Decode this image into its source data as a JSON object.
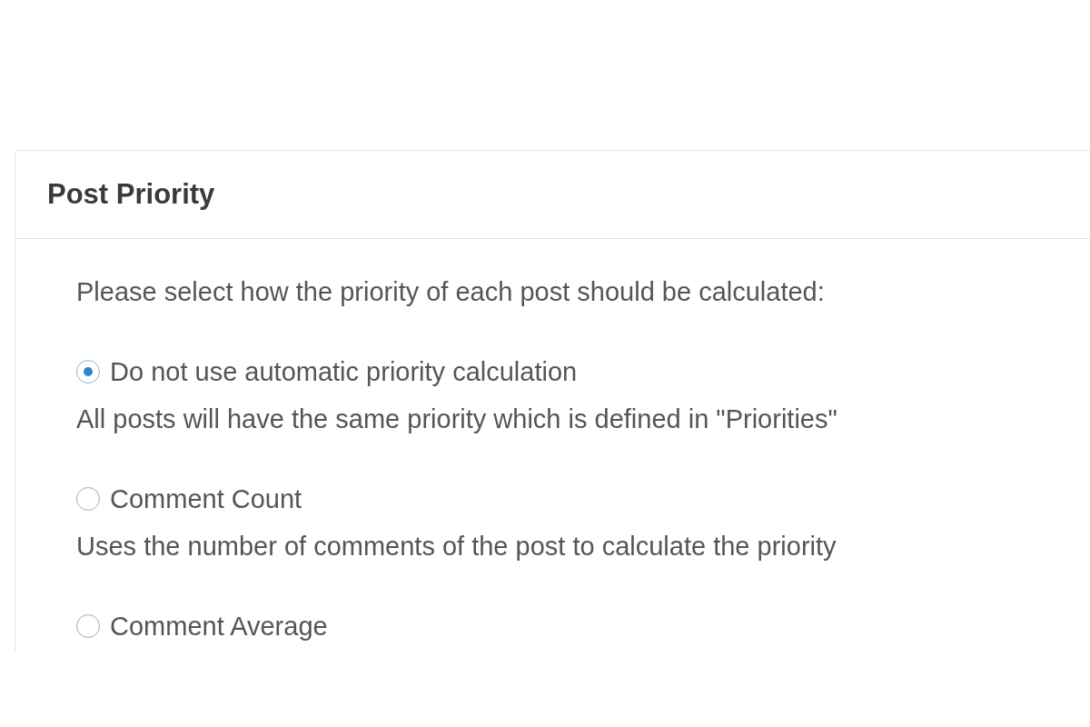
{
  "panel": {
    "title": "Post Priority",
    "intro": "Please select how the priority of each post should be calculated:",
    "options": [
      {
        "label": "Do not use automatic priority calculation",
        "description": "All posts will have the same priority which is defined in \"Priorities\"",
        "selected": true
      },
      {
        "label": "Comment Count",
        "description": "Uses the number of comments of the post to calculate the priority",
        "selected": false
      },
      {
        "label": "Comment Average",
        "selected": false
      }
    ]
  }
}
